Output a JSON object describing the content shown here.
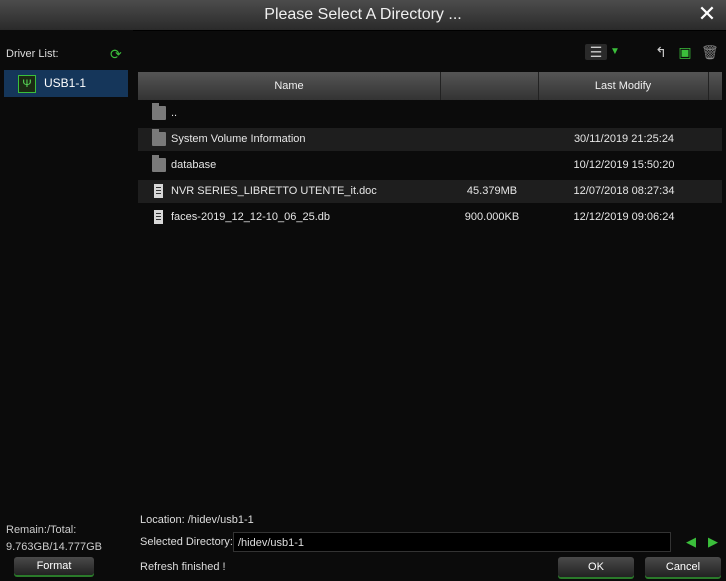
{
  "dialog": {
    "title": "Please Select A Directory ..."
  },
  "left": {
    "driver_list_label": "Driver List:",
    "drives": [
      {
        "label": "USB1-1"
      }
    ],
    "remain_label": "Remain:/Total:",
    "remain_value": "9.763GB/14.777GB",
    "format_button": "Format"
  },
  "table": {
    "headers": {
      "name": "Name",
      "size": "",
      "date": "Last Modify"
    },
    "rows": [
      {
        "type": "folder",
        "name": "..",
        "size": "",
        "date": ""
      },
      {
        "type": "folder",
        "name": "System Volume Information",
        "size": "",
        "date": "30/11/2019 21:25:24"
      },
      {
        "type": "folder",
        "name": "database",
        "size": "",
        "date": "10/12/2019 15:50:20"
      },
      {
        "type": "file",
        "name": "NVR SERIES_LIBRETTO UTENTE_it.doc",
        "size": "45.379MB",
        "date": "12/07/2018 08:27:34"
      },
      {
        "type": "file",
        "name": "faces-2019_12_12-10_06_25.db",
        "size": "900.000KB",
        "date": "12/12/2019 09:06:24"
      }
    ]
  },
  "footer": {
    "location": "Location: /hidev/usb1-1",
    "selected_label": "Selected Directory:",
    "selected_value": "/hidev/usb1-1",
    "status": "Refresh finished !",
    "ok": "OK",
    "cancel": "Cancel"
  },
  "icons": {
    "close": "close-icon",
    "refresh": "refresh-icon",
    "usb": "usb-icon",
    "list_view": "list-view-icon",
    "back": "back-icon",
    "new_folder": "new-folder-icon",
    "delete": "trash-icon",
    "prev": "arrow-left-icon",
    "next": "arrow-right-icon"
  },
  "colors": {
    "accent_green": "#3bbf3b",
    "selected_blue": "#15365a"
  }
}
